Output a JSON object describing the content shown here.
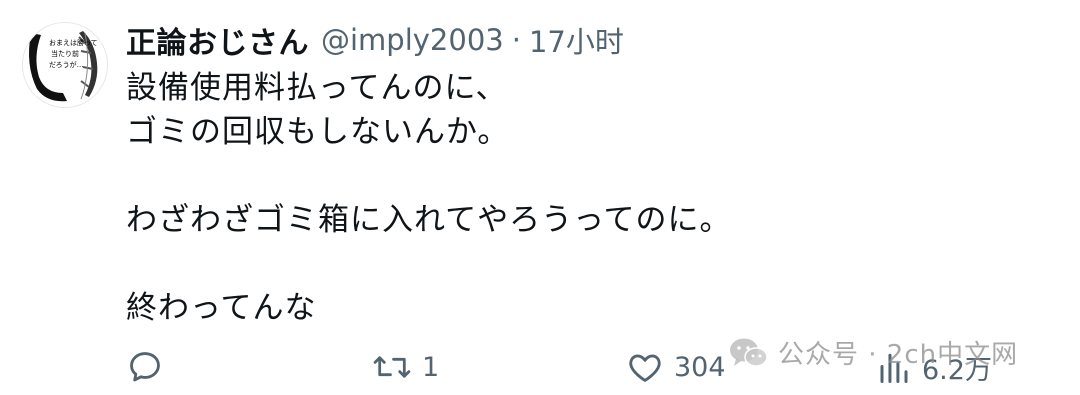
{
  "tweet": {
    "author": {
      "display_name": "正論おじさん",
      "handle": "@imply2003",
      "separator": "·",
      "timestamp": "17小时"
    },
    "avatar_text": "おまえは勝って当たり前だろうが……",
    "lines": [
      "設備使用料払ってんのに、",
      "ゴミの回収もしないんか。",
      "",
      "わざわざゴミ箱に入れてやろうってのに。",
      "",
      "終わってんな"
    ]
  },
  "actions": {
    "reply": {
      "icon": "reply-icon",
      "count": ""
    },
    "retweet": {
      "icon": "retweet-icon",
      "count": "1"
    },
    "like": {
      "icon": "heart-icon",
      "count": "304"
    },
    "views": {
      "icon": "views-icon",
      "count": "6.2万"
    }
  },
  "watermark": {
    "icon": "wechat-icon",
    "text": "公众号 · 2ch中文网"
  },
  "colors": {
    "text_primary": "#0f1419",
    "text_secondary": "#536471",
    "background": "#ffffff"
  }
}
